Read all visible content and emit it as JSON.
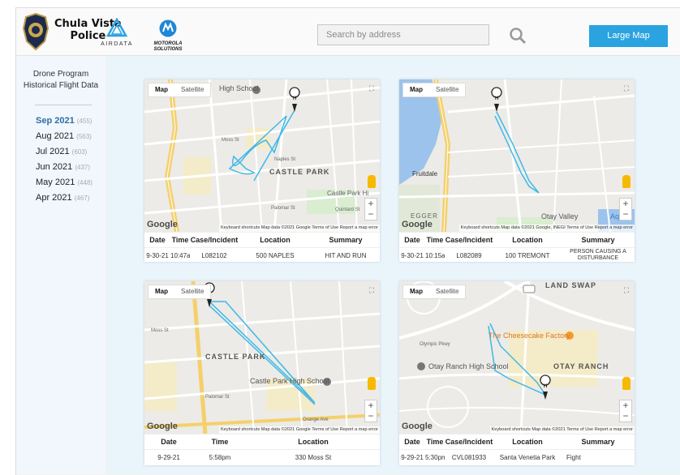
{
  "header": {
    "police_title_line1": "Chula Vista",
    "police_title_line2": "Police",
    "airdata_label": "AIRDATA",
    "moto_label_line1": "MOTOROLA",
    "moto_label_line2": "SOLUTIONS",
    "search_placeholder": "Search by address",
    "large_map_label": "Large Map",
    "accent_color": "#2aa3e0"
  },
  "sidebar": {
    "title_line1": "Drone Program",
    "title_line2": "Historical Flight Data",
    "months": [
      {
        "label": "Sep 2021",
        "count": "(455)",
        "active": true
      },
      {
        "label": "Aug 2021",
        "count": "(563)"
      },
      {
        "label": "Jul 2021",
        "count": "(603)"
      },
      {
        "label": "Jun 2021",
        "count": "(437)"
      },
      {
        "label": "May 2021",
        "count": "(448)"
      },
      {
        "label": "Apr 2021",
        "count": "(467)"
      }
    ]
  },
  "map_controls": {
    "map_tab": "Map",
    "satellite_tab": "Satellite",
    "google": "Google",
    "keyboard": "Keyboard shortcuts",
    "terms": "Terms of Use",
    "report": "Report a map error",
    "zoom_in": "+",
    "zoom_out": "−"
  },
  "cards": [
    {
      "map_data": "Map data ©2021 Google",
      "labels": {
        "castle_park": "CASTLE PARK",
        "castle_park_high": "Castle Park Hi",
        "school": "High School",
        "naples": "Naples St",
        "moss": "Moss St",
        "palomar": "Palomar St",
        "quintard": "Quintard St"
      },
      "headers": [
        "Date",
        "Time",
        "Case/Incident",
        "Location",
        "Summary"
      ],
      "row": [
        "9-30-21",
        "10:47am",
        "L082102",
        "500 NAPLES",
        "HIT AND RUN"
      ]
    },
    {
      "map_data": "Map data ©2021 Google, INEGI",
      "labels": {
        "fruitdale": "Fruitdale",
        "otay": "Otay Valley",
        "egger": "EGGER",
        "aqu": "Aqu"
      },
      "headers": [
        "Date",
        "Time",
        "Case/Incident",
        "Location",
        "Summary"
      ],
      "row": [
        "9-30-21",
        "10:15am",
        "L082089",
        "100 TREMONT",
        "PERSON CAUSING A DISTURBANCE"
      ]
    },
    {
      "map_data": "Map data ©2021 Google",
      "labels": {
        "castle_park": "CASTLE PARK",
        "school": "Castle Park High School",
        "moss": "Moss St",
        "palomar": "Palomar St",
        "orange": "Orange Ave"
      },
      "headers": [
        "Date",
        "Time",
        "Location"
      ],
      "row": [
        "9-29-21",
        "5:58pm",
        "330 Moss St"
      ]
    },
    {
      "map_data": "Map data ©2021",
      "labels": {
        "land_swap": "LAND SWAP",
        "cheesecake": "The Cheesecake Factory",
        "otay_high": "Otay Ranch High School",
        "otay_ranch": "OTAY RANCH",
        "olympic": "Olympic Pkwy"
      },
      "headers": [
        "Date",
        "Time",
        "Case/Incident",
        "Location",
        "Summary"
      ],
      "row": [
        "9-29-21",
        "5:30pm",
        "CVL081933",
        "Santa Venetia Park",
        "Fight"
      ]
    }
  ]
}
